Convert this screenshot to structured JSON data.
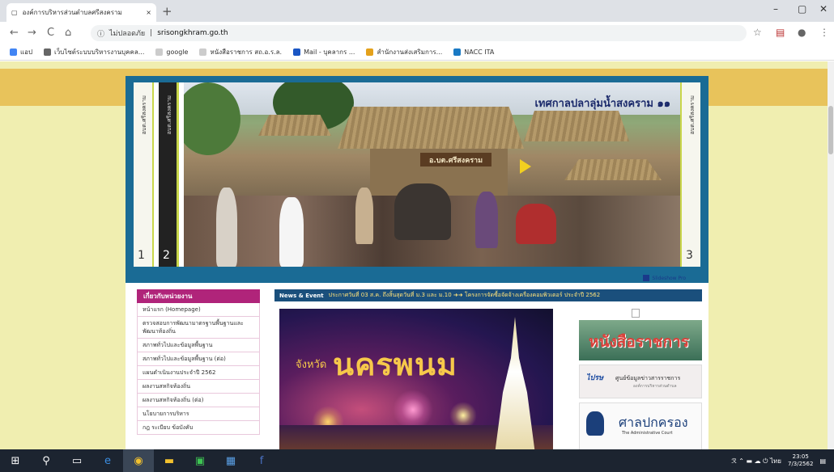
{
  "browser": {
    "tab_title": "องค์การบริหารส่วนตำบลศรีสงคราม",
    "tab_close": "×",
    "new_tab": "+",
    "window_controls": [
      "–",
      "▢",
      "✕"
    ],
    "nav": {
      "back": "←",
      "forward": "→",
      "reload": "C",
      "home": "⌂"
    },
    "omnibox_secure_label": "ไม่ปลอดภัย",
    "omnibox_url": "srisongkhram.go.th",
    "bookmarks": [
      {
        "label": "แอป",
        "color": "#4285f4"
      },
      {
        "label": "เว็บไซต์ระบบบริหารงานบุคคล...",
        "color": "#666666"
      },
      {
        "label": "google",
        "color": "#999999"
      },
      {
        "label": "หนังสือราชการ สถ.อ.ร.ล.",
        "color": "#999999"
      },
      {
        "label": "Mail - บุคลากร ...",
        "color": "#1a56c4"
      },
      {
        "label": "สำนักงานส่งเสริมการ...",
        "color": "#e4a11b"
      },
      {
        "label": "NACC ITA",
        "color": "#1a7ac4"
      }
    ]
  },
  "banner": {
    "title": "เทศกาลปลาลุ่มน้ำสงคราม ๑๑",
    "sign_text": "อ.บต.ศรีสงคราม",
    "slide_tabs": [
      {
        "label": "อบต.ศรีสงคราม",
        "number": "1",
        "dark": false
      },
      {
        "label": "อบต.ศรีสงคราม",
        "number": "2",
        "dark": true
      },
      {
        "label": "อบต.ศรีสงคราม",
        "number": "3",
        "dark": false
      }
    ],
    "footer": "Slideshow Pro"
  },
  "sidebar": {
    "heading": "เกี่ยวกับหน่วยงาน",
    "items": [
      "หน้าแรก (Homepage)",
      "ตรวจสอบการพัฒนามาตรฐานพื้นฐานและพัฒนาท้องถิ่น",
      "สภาพทั่วไปและข้อมูลพื้นฐาน",
      "สภาพทั่วไปและข้อมูลพื้นฐาน (ต่อ)",
      "แผนดำเนินงานประจำปี 2562",
      "ผลงานสหกิจท้องถิ่น",
      "ผลงานสหกิจท้องถิ่น (ต่อ)",
      "นโยบายการบริหาร",
      "กฎ ระเบียบ ข้อบังคับ"
    ]
  },
  "news": {
    "title": "News & Event",
    "ticker": "ประกาศวันที่ 03 ส.ค. ถึงสิ้นสุดวันที่ ม.3 และ ม.10  ➜➜  โครงการจัดซื้อจัดจ้างเครื่องคอมพิวเตอร์ ประจำปี 2562"
  },
  "poster": {
    "small_text": "จังหวัด",
    "big_text": "นครพนม"
  },
  "ads": {
    "ad1": "หนังสือราชการ",
    "ad2_logo": "ไปรษ",
    "ad2_title": "ศูนย์ข้อมูลข่าวสารราชการ",
    "ad2_sub": "องค์การบริหารส่วนตำบล",
    "ad3_title": "ศาลปกครอง",
    "ad3_sub": "The Administrative Court"
  },
  "taskbar": {
    "items": [
      {
        "name": "start-icon",
        "glyph": "⊞"
      },
      {
        "name": "search-icon",
        "glyph": "⚲"
      },
      {
        "name": "task-view-icon",
        "glyph": "▭"
      },
      {
        "name": "edge-icon",
        "glyph": "e"
      },
      {
        "name": "chrome-icon",
        "glyph": "◉"
      },
      {
        "name": "file-explorer-icon",
        "glyph": "▬"
      },
      {
        "name": "line-icon",
        "glyph": "▣"
      },
      {
        "name": "photos-icon",
        "glyph": "▦"
      },
      {
        "name": "facebook-icon",
        "glyph": "f"
      }
    ],
    "tray_icons": "ℛ ⌃ ▬ ☁ ⏻ ไทย",
    "time": "23:05",
    "date": "7/3/2562"
  }
}
